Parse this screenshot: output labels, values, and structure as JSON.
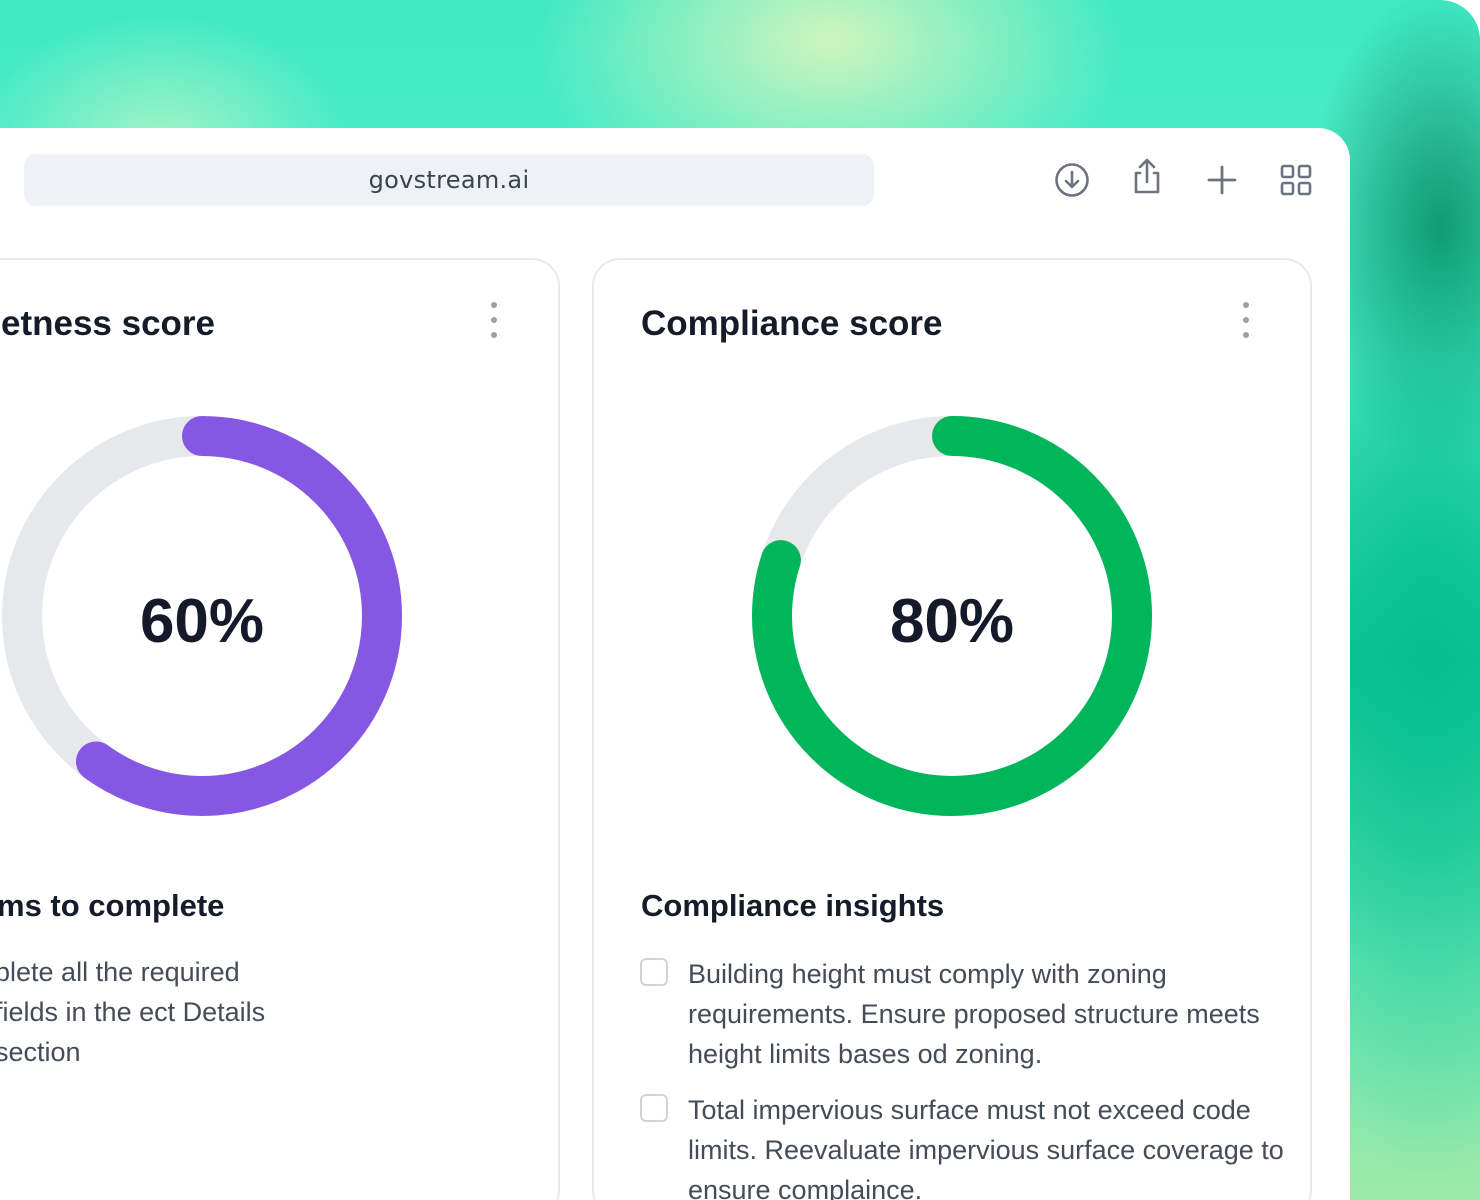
{
  "browser": {
    "url": "govstream.ai",
    "toolbar_icons": [
      "download-icon",
      "share-icon",
      "plus-icon",
      "grid-icon"
    ]
  },
  "colors": {
    "completeness_accent": "#8657e2",
    "compliance_accent": "#00b55a",
    "track": "#e7e8eb"
  },
  "completeness_card": {
    "title": "etness score",
    "score": 0.6,
    "score_label": "60%",
    "section_title": "ms to complete",
    "item_text": "plete all the required fields in the ect Details section"
  },
  "compliance_card": {
    "title": "Compliance score",
    "score": 0.8,
    "score_label": "80%",
    "section_title": "Compliance insights",
    "insights": [
      {
        "text": "Building height must comply with zoning requirements. Ensure proposed structure meets height limits bases od zoning.",
        "checked": false
      },
      {
        "text": "Total impervious surface must not exceed code limits. Reevaluate impervious surface coverage to ensure complaince.",
        "checked": false
      }
    ]
  }
}
